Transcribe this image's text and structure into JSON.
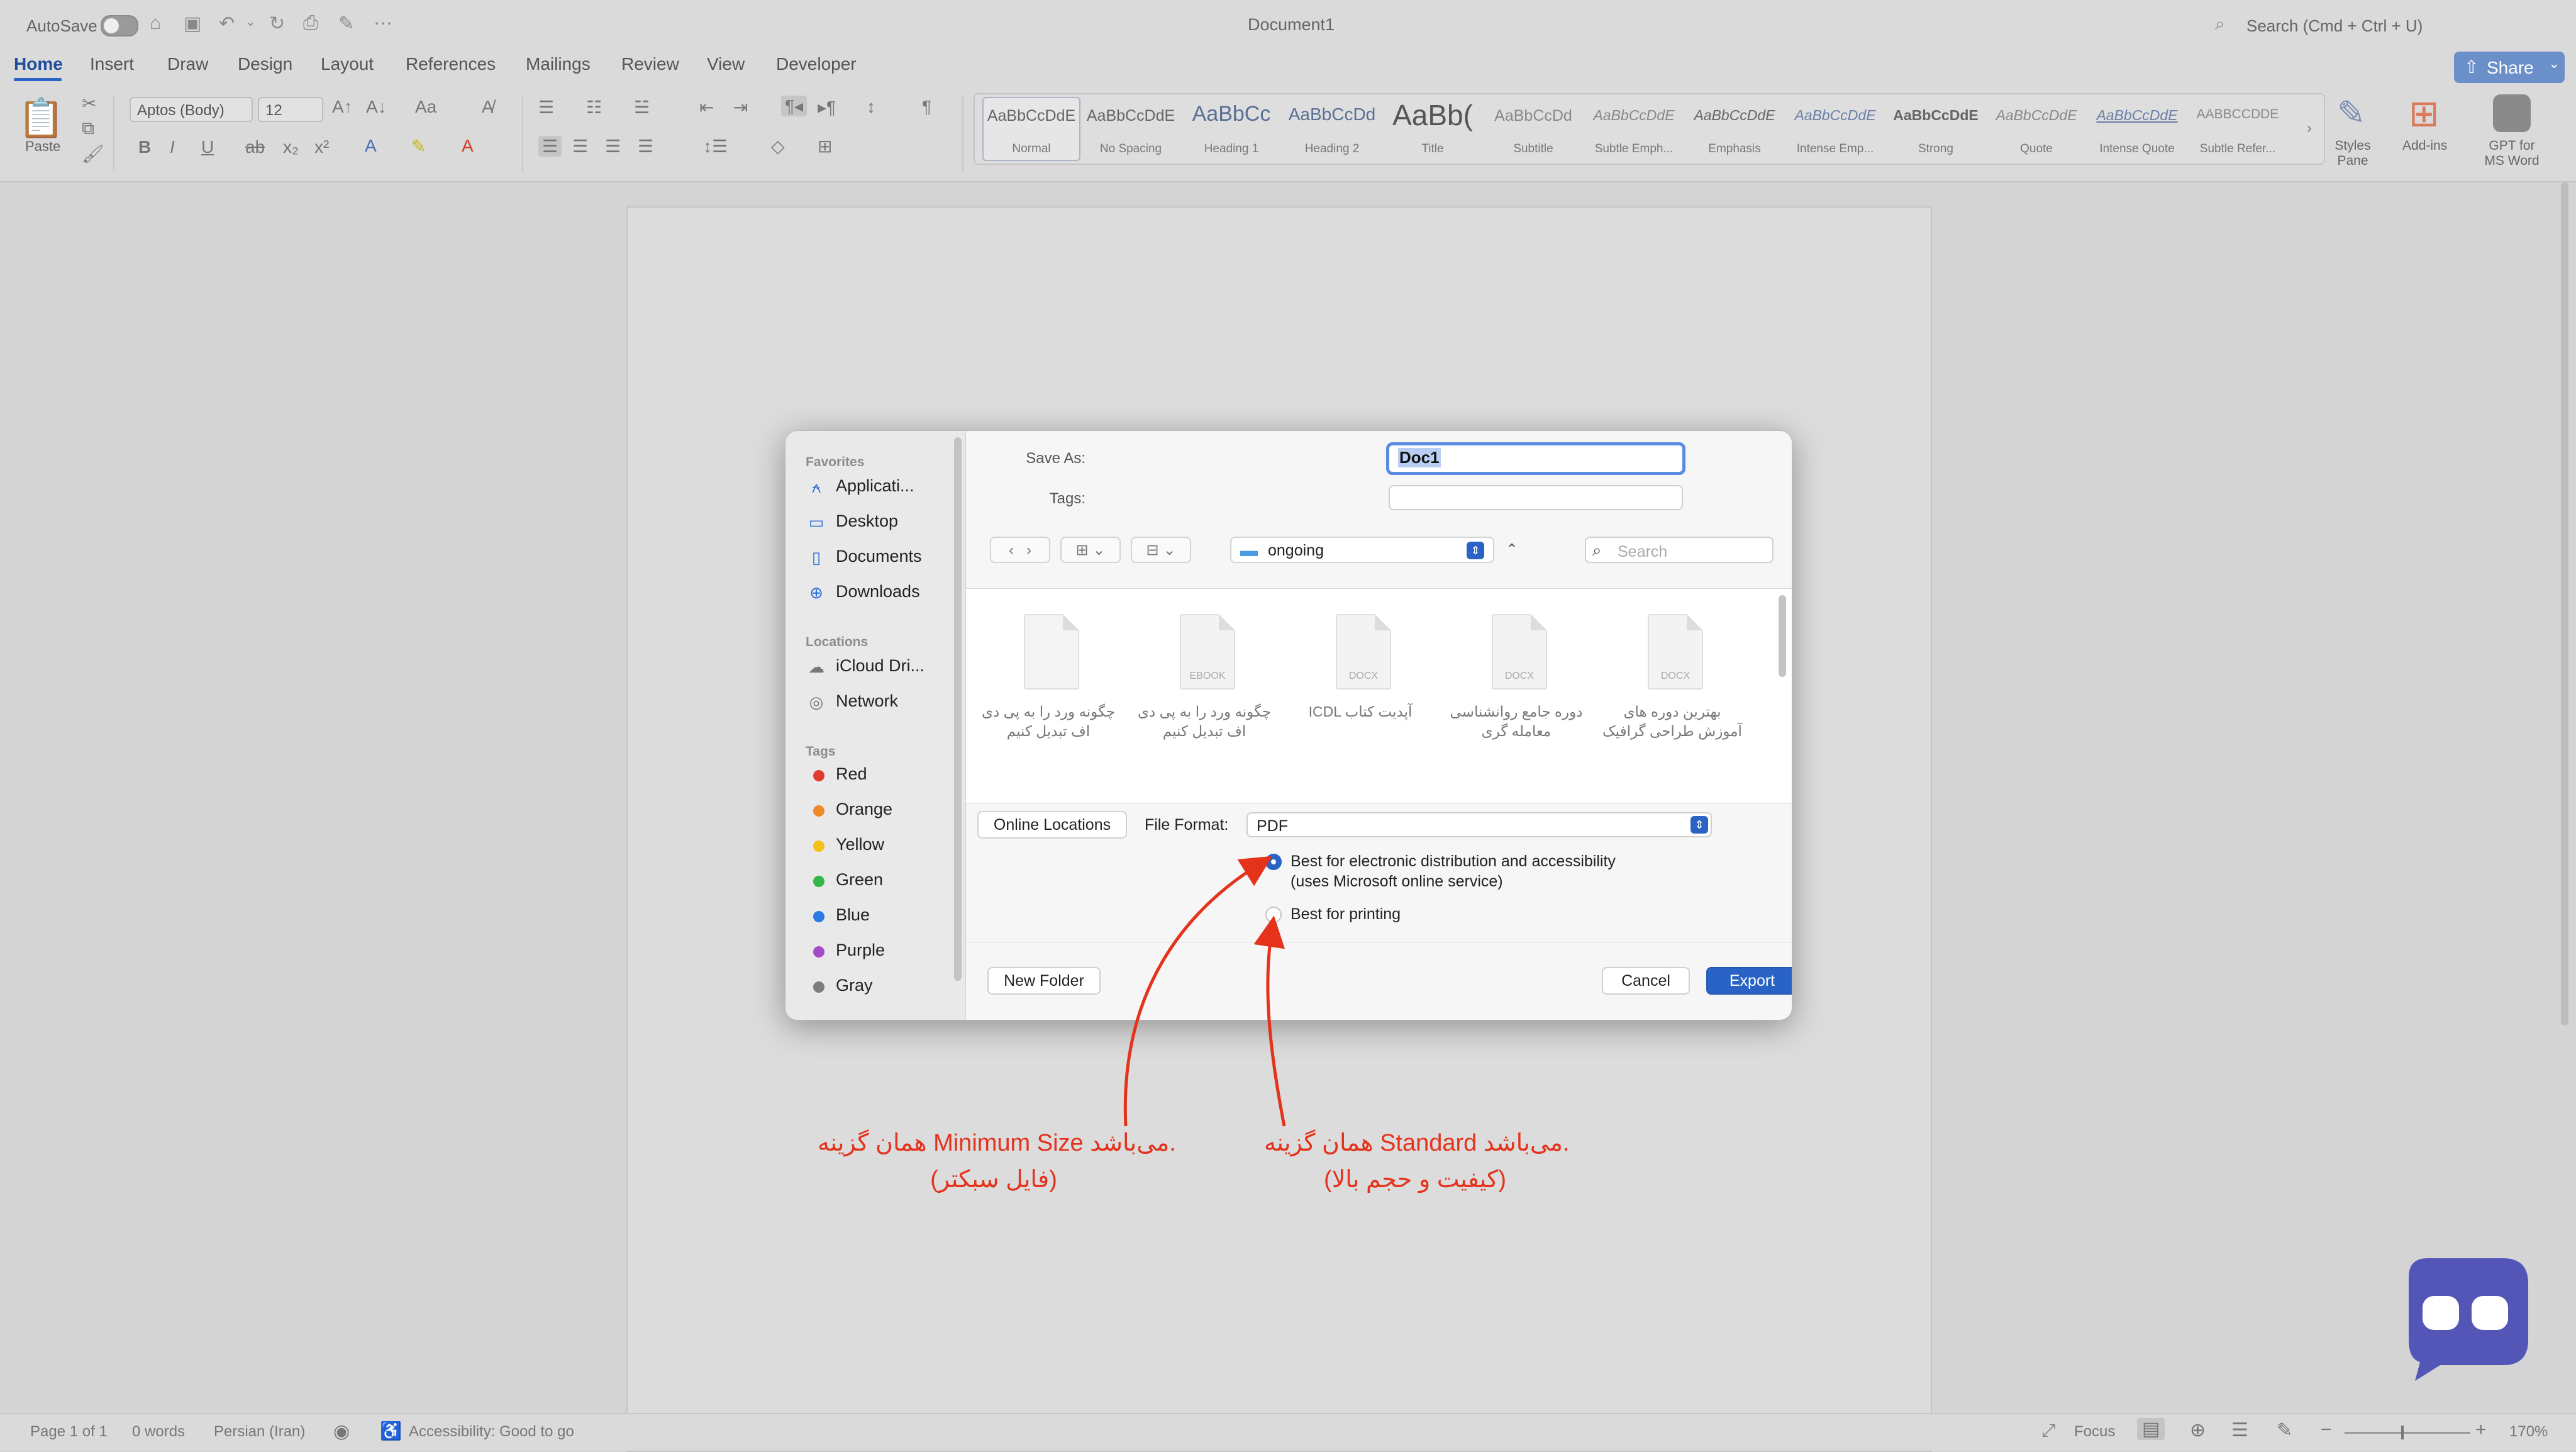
{
  "titlebar": {
    "autosave_label": "AutoSave",
    "document_title": "Document1",
    "search_placeholder": "Search (Cmd + Ctrl + U)"
  },
  "ribbon_tabs": [
    "Home",
    "Insert",
    "Draw",
    "Design",
    "Layout",
    "References",
    "Mailings",
    "Review",
    "View",
    "Developer"
  ],
  "share_label": "Share",
  "ribbon": {
    "paste_label": "Paste",
    "font_name": "Aptos (Body)",
    "font_size": "12",
    "styles": [
      {
        "sample": "AaBbCcDdE",
        "name": "Normal"
      },
      {
        "sample": "AaBbCcDdE",
        "name": "No Spacing"
      },
      {
        "sample": "AaBbCc",
        "name": "Heading 1"
      },
      {
        "sample": "AaBbCcDd",
        "name": "Heading 2"
      },
      {
        "sample": "AaBb(",
        "name": "Title"
      },
      {
        "sample": "AaBbCcDd",
        "name": "Subtitle"
      },
      {
        "sample": "AaBbCcDdE",
        "name": "Subtle Emph..."
      },
      {
        "sample": "AaBbCcDdE",
        "name": "Emphasis"
      },
      {
        "sample": "AaBbCcDdE",
        "name": "Intense Emp..."
      },
      {
        "sample": "AaBbCcDdE",
        "name": "Strong"
      },
      {
        "sample": "AaBbCcDdE",
        "name": "Quote"
      },
      {
        "sample": "AaBbCcDdE",
        "name": "Intense Quote"
      },
      {
        "sample": "AABBCCDDE",
        "name": "Subtle Refer..."
      }
    ],
    "styles_pane_label": "Styles Pane",
    "addins_label": "Add-ins",
    "gpt_label": "GPT for MS Word"
  },
  "dialog": {
    "sidebar": {
      "favorites_header": "Favorites",
      "favorites": [
        {
          "label": "Applicati...",
          "icon": "applications-icon"
        },
        {
          "label": "Desktop",
          "icon": "desktop-icon"
        },
        {
          "label": "Documents",
          "icon": "documents-icon"
        },
        {
          "label": "Downloads",
          "icon": "downloads-icon"
        }
      ],
      "locations_header": "Locations",
      "locations": [
        {
          "label": "iCloud Dri...",
          "icon": "icloud-icon"
        },
        {
          "label": "Network",
          "icon": "network-icon"
        }
      ],
      "tags_header": "Tags",
      "tags": [
        {
          "label": "Red",
          "color": "#e23b2e"
        },
        {
          "label": "Orange",
          "color": "#f0882a"
        },
        {
          "label": "Yellow",
          "color": "#f2c21b"
        },
        {
          "label": "Green",
          "color": "#33b94a"
        },
        {
          "label": "Blue",
          "color": "#2c7be5"
        },
        {
          "label": "Purple",
          "color": "#a54cc9"
        },
        {
          "label": "Gray",
          "color": "#7d7d7d"
        }
      ]
    },
    "save_as_label": "Save As:",
    "save_as_value": "Doc1",
    "tags_label": "Tags:",
    "location": "ongoing",
    "search_placeholder": "Search",
    "files": [
      {
        "name_line1": "چگونه ورد را به پی دی",
        "name_line2": "اف تبدیل کنیم",
        "tag": ""
      },
      {
        "name_line1": "چگونه ورد را به پی دی",
        "name_line2": "اف تبدیل کنیم",
        "tag": "EBOOK"
      },
      {
        "name_line1": "ICDL آپدیت کتاب",
        "name_line2": "",
        "tag": "DOCX"
      },
      {
        "name_line1": "دوره جامع روانشناسی",
        "name_line2": "معامله گری",
        "tag": "DOCX"
      },
      {
        "name_line1": "بهترین دوره های",
        "name_line2": "آموزش طراحی گرافیک",
        "tag": "DOCX"
      }
    ],
    "online_locations_label": "Online Locations",
    "file_format_label": "File Format:",
    "file_format_value": "PDF",
    "option1_line1": "Best for electronic distribution and accessibility",
    "option1_line2": "(uses Microsoft online service)",
    "option2": "Best for printing",
    "new_folder_label": "New Folder",
    "cancel_label": "Cancel",
    "export_label": "Export"
  },
  "annotations": {
    "left_line1": "همان گزینه Minimum Size می‌باشد.",
    "left_line2": "(فایل سبکتر)",
    "right_line1": "همان گزینه Standard می‌باشد.",
    "right_line2": "(کیفیت و حجم بالا)",
    "color": "#e4321b"
  },
  "statusbar": {
    "page": "Page 1 of 1",
    "words": "0 words",
    "language": "Persian (Iran)",
    "accessibility": "Accessibility: Good to go",
    "focus": "Focus",
    "zoom": "170%"
  }
}
